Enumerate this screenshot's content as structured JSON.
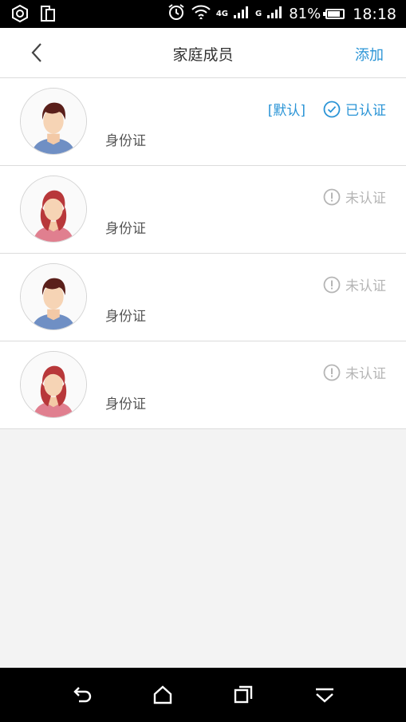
{
  "status_bar": {
    "network_label": "4G",
    "carrier_label": "G",
    "battery_percent": "81%",
    "battery_level": 0.81,
    "time": "18:18",
    "icons": [
      "settings-icon",
      "sim-icon",
      "alarm-icon",
      "wifi-icon",
      "signal-icon",
      "battery-icon"
    ]
  },
  "header": {
    "title": "家庭成员",
    "action_label": "添加",
    "back_icon": "chevron-left-icon"
  },
  "members": [
    {
      "avatar": "male-avatar",
      "id_type": "身份证",
      "default_label": "[默认]",
      "status_label": "已认证",
      "verified": true
    },
    {
      "avatar": "female-avatar",
      "id_type": "身份证",
      "status_label": "未认证",
      "verified": false
    },
    {
      "avatar": "male-avatar",
      "id_type": "身份证",
      "status_label": "未认证",
      "verified": false
    },
    {
      "avatar": "female-avatar",
      "id_type": "身份证",
      "status_label": "未认证",
      "verified": false
    }
  ],
  "colors": {
    "accent": "#2a94d6",
    "muted": "#b5b5b5",
    "background": "#f3f3f3"
  },
  "bottom_nav": [
    "back-nav-icon",
    "home-icon",
    "recents-icon",
    "collapse-icon"
  ]
}
